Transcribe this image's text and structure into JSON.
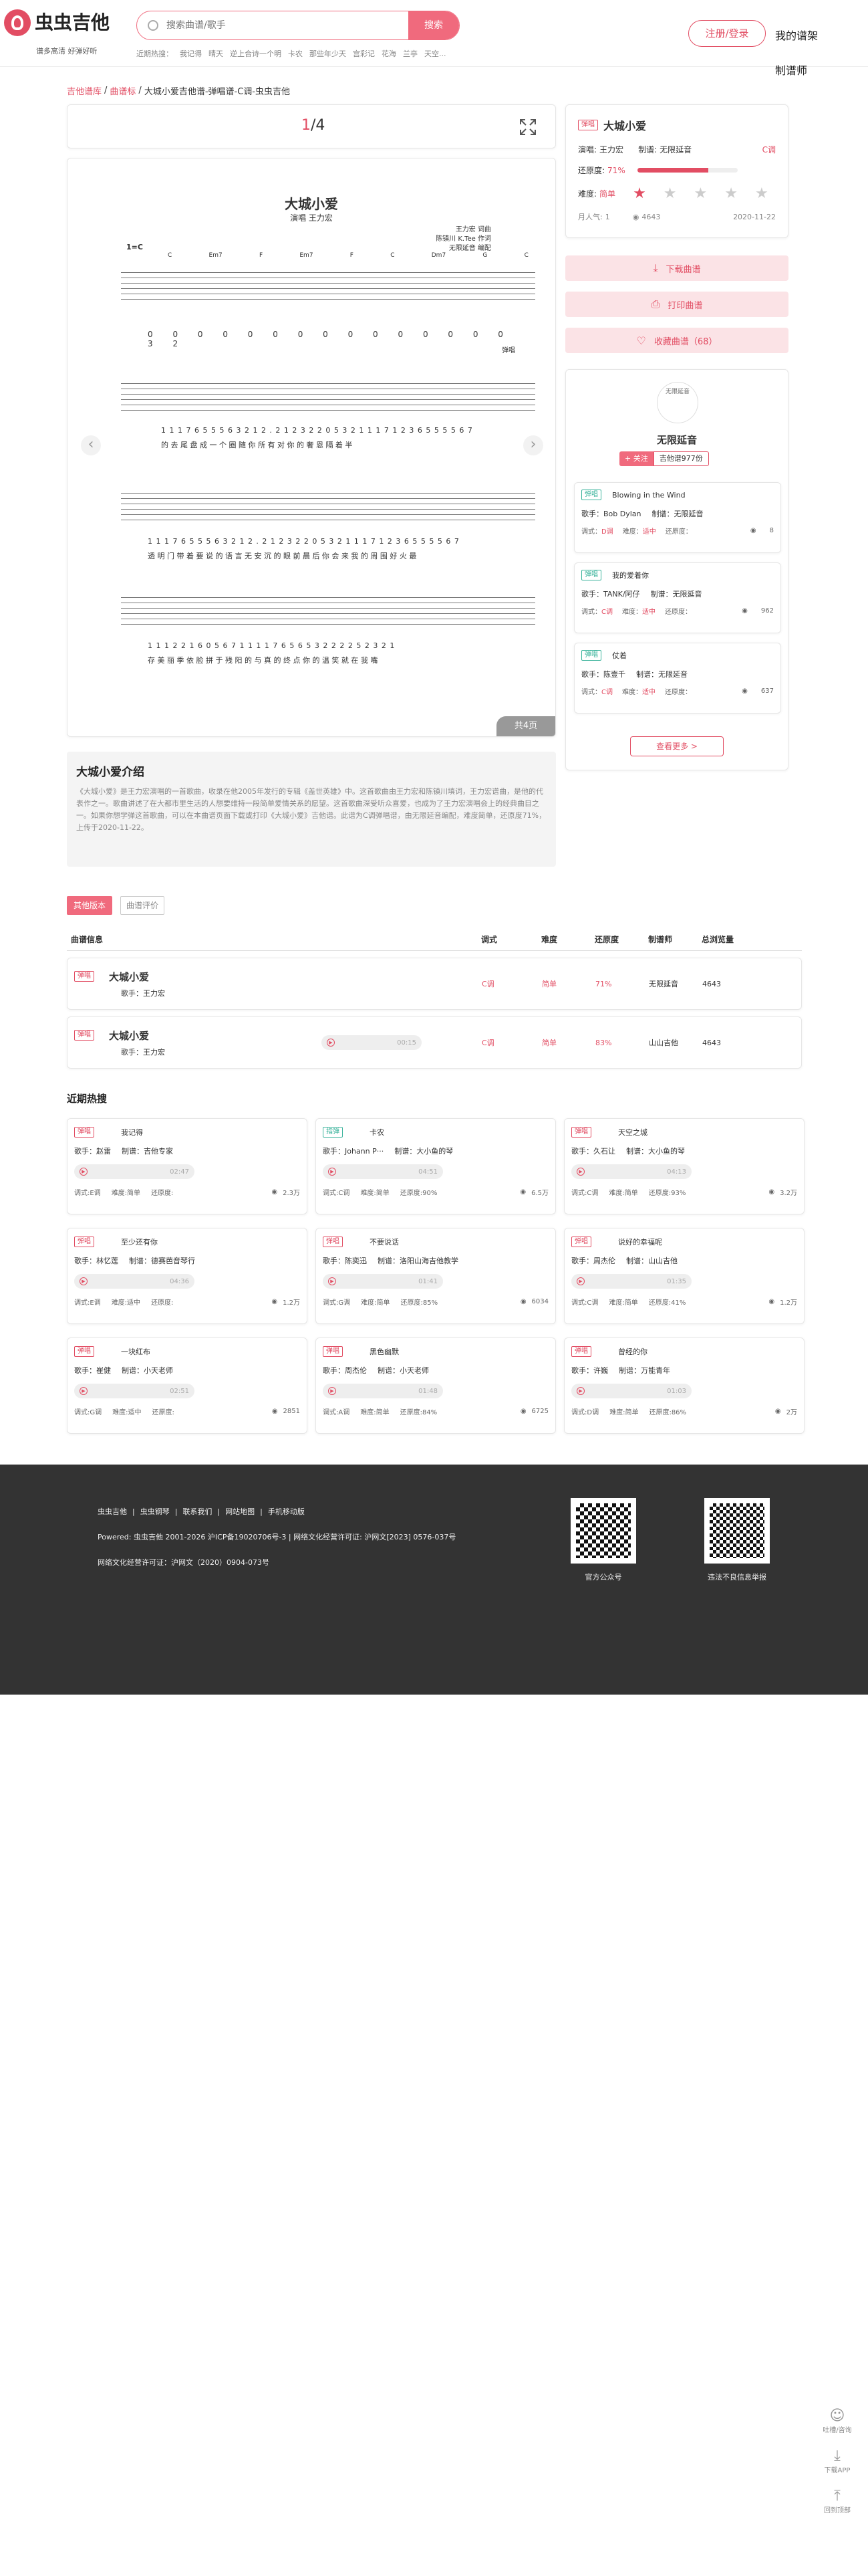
{
  "header": {
    "logo_text": "虫虫吉他",
    "tagline": "谱多高清 好弹好听",
    "search_placeholder": "搜索曲谱/歌手",
    "search_button": "搜索",
    "hot_label": "近期热搜：",
    "hot_terms": [
      "我记得",
      "晴天",
      "逆上合诗一个明",
      "卡农",
      "那些年少天",
      "宫彩记",
      "花海",
      "兰亭",
      "天空..."
    ],
    "login_button": "注册/登录",
    "my_scores": "我的谱架",
    "nav_maker": "制谱师"
  },
  "breadcrumb": {
    "home": "吉他谱库",
    "category": "曲谱标",
    "current": "大城小爱吉他谱-弹唱谱-C调-虫虫吉他"
  },
  "viewer": {
    "page_current": "1",
    "page_sep": "/4",
    "total_pages": "共4页",
    "sheet_title": "大城小爱",
    "sheet_sub": "演唱 王力宏",
    "credits": [
      "王力宏 词曲",
      "陈镇川 K.Tee 作词",
      "无限延音 编配"
    ],
    "key_sign": "1=C",
    "player_tag": "弹唱",
    "lyrics_1": "的 去 尾 盘 成 一 个 圈 随 你 所 有 对 你 的 奢 恩 隔 着 半",
    "lyrics_2": "透 明 门 带 着 要 说 的 语 言 无 安 沉 的 眼 前 晨 后 你 会 来 我 的 周 围 好 火 最",
    "lyrics_3": "存 美 丽 季 依 脸 拼 于 残 阳 的 与 真 的 终 点 你 的 温 笑 就 在 我 嘴",
    "numbers_1": "1 1 1 7 6 5 5 5 6 3 2 1 2 . 2 1 2 3 2 2 0 5 3 2 1 1 1 7 1 2 3 6 5 5 5 5 6 7",
    "numbers_2": "1 1 1 2 2 1 6 0 5 6 7 1 1 1 1 7 6 5 6 5 3 2 2 2 2 5 2 3 2 1"
  },
  "song": {
    "tag": "弹唱",
    "title": "大城小爱",
    "singer_label": "演唱:",
    "singer": "王力宏",
    "maker_label": "制谱:",
    "maker": "无限延音",
    "key": "C调",
    "restore_label": "还原度:",
    "restore_value": "71%",
    "restore_fraction": 0.71,
    "difficulty_label": "难度:",
    "difficulty": "简单",
    "difficulty_stars": 1,
    "popularity_label": "月人气:",
    "popularity": "1",
    "views": "4643",
    "date": "2020-11-22"
  },
  "actions": {
    "download": "下载曲谱",
    "print": "打印曲谱",
    "favorite": "收藏曲谱",
    "favorite_count": "（68）"
  },
  "author": {
    "avatar_alt": "无限延音",
    "name": "无限延音",
    "follow": "+ 关注",
    "score_count": "吉他谱977份",
    "songs": [
      {
        "tag": "弹唱",
        "title": "Blowing in the Wind",
        "singer_label": "歌手：",
        "singer": "Bob Dylan",
        "maker_label": "制谱：",
        "maker": "无限延音",
        "key_label": "调式：",
        "key": "D调",
        "diff_label": "难度：",
        "diff": "适中",
        "restore_label": "还原度：",
        "views": "8"
      },
      {
        "tag": "弹唱",
        "title": "我的爱着你",
        "singer_label": "歌手：",
        "singer": "TANK/阿仔",
        "maker_label": "制谱：",
        "maker": "无限延音",
        "key_label": "调式：",
        "key": "C调",
        "diff_label": "难度：",
        "diff": "适中",
        "restore_label": "还原度：",
        "views": "962"
      },
      {
        "tag": "弹唱",
        "title": "仗着",
        "singer_label": "歌手：",
        "singer": "陈壹千",
        "maker_label": "制谱：",
        "maker": "无限延音",
        "key_label": "调式：",
        "key": "C调",
        "diff_label": "难度：",
        "diff": "适中",
        "restore_label": "还原度：",
        "views": "637"
      }
    ],
    "more": "查看更多 >"
  },
  "intro": {
    "title": "大城小爱介绍",
    "text": "《大城小爱》是王力宏演唱的一首歌曲，收录在他2005年发行的专辑《盖世英雄》中。这首歌曲由王力宏和陈镇川填词，王力宏谱曲，是他的代表作之一。歌曲讲述了在大都市里生活的人想要维持一段简单爱情关系的愿望。这首歌曲深受听众喜爱，也成为了王力宏演唱会上的经典曲目之一。如果你想学弹这首歌曲，可以在本曲谱页面下载或打印《大城小爱》吉他谱。此谱为C调弹唱谱，由无限延音编配，难度简单，还原度71%，上传于2020-11-22。"
  },
  "versions": {
    "tab_other": "其他版本",
    "tab_review": "曲谱评价",
    "headers": [
      "曲谱信息",
      "调式",
      "难度",
      "还原度",
      "制谱师",
      "总浏览量"
    ],
    "rows": [
      {
        "tag": "弹唱",
        "title": "大城小爱",
        "singer": "歌手：王力宏",
        "audio": "",
        "key": "C调",
        "diff": "简单",
        "restore": "71%",
        "maker": "无限延音",
        "views": "4643"
      },
      {
        "tag": "弹唱",
        "title": "大城小爱",
        "singer": "歌手：王力宏",
        "audio": "00:15",
        "key": "C调",
        "diff": "简单",
        "restore": "83%",
        "maker": "山山吉他",
        "views": "4643"
      }
    ]
  },
  "hot": {
    "title": "近期热搜",
    "cards": [
      {
        "tag": "弹唱",
        "green": false,
        "title": "我记得",
        "singer": "歌手：赵雷",
        "maker": "制谱：吉他专家",
        "audio": "02:47",
        "key": "调式:E调",
        "diff": "难度:简单",
        "restore": "还原度:",
        "views": "2.3万"
      },
      {
        "tag": "指弹",
        "green": true,
        "title": "卡农",
        "singer": "歌手：Johann P···",
        "maker": "制谱：大小鱼的琴",
        "audio": "04:51",
        "key": "调式:C调",
        "diff": "难度:简单",
        "restore": "还原度:90%",
        "views": "6.5万"
      },
      {
        "tag": "弹唱",
        "green": false,
        "title": "天空之城",
        "singer": "歌手：久石让",
        "maker": "制谱：大小鱼的琴",
        "audio": "04:13",
        "key": "调式:C调",
        "diff": "难度:简单",
        "restore": "还原度:93%",
        "views": "3.2万"
      },
      {
        "tag": "弹唱",
        "green": false,
        "title": "至少还有你",
        "singer": "歌手：林忆莲",
        "maker": "制谱：德赛芭音琴行",
        "audio": "04:36",
        "key": "调式:E调",
        "diff": "难度:适中",
        "restore": "还原度:",
        "views": "1.2万"
      },
      {
        "tag": "弹唱",
        "green": false,
        "title": "不要说话",
        "singer": "歌手：陈奕迅",
        "maker": "制谱：洛阳山海吉他教学",
        "audio": "01:41",
        "key": "调式:G调",
        "diff": "难度:简单",
        "restore": "还原度:85%",
        "views": "6034"
      },
      {
        "tag": "弹唱",
        "green": false,
        "title": "说好的幸福呢",
        "singer": "歌手：周杰伦",
        "maker": "制谱：山山吉他",
        "audio": "01:35",
        "key": "调式:C调",
        "diff": "难度:简单",
        "restore": "还原度:41%",
        "views": "1.2万"
      },
      {
        "tag": "弹唱",
        "green": false,
        "title": "一块红布",
        "singer": "歌手：崔健",
        "maker": "制谱：小天老师",
        "audio": "02:51",
        "key": "调式:G调",
        "diff": "难度:适中",
        "restore": "还原度:",
        "views": "2851"
      },
      {
        "tag": "弹唱",
        "green": false,
        "title": "黑色幽默",
        "singer": "歌手：周杰伦",
        "maker": "制谱：小天老师",
        "audio": "01:48",
        "key": "调式:A调",
        "diff": "难度:简单",
        "restore": "还原度:84%",
        "views": "6725"
      },
      {
        "tag": "弹唱",
        "green": false,
        "title": "曾经的你",
        "singer": "歌手：许巍",
        "maker": "制谱：万能青年",
        "audio": "01:03",
        "key": "调式:D调",
        "diff": "难度:简单",
        "restore": "还原度:86%",
        "views": "2万"
      }
    ]
  },
  "footer": {
    "links": [
      "虫虫吉他",
      "虫虫钢琴",
      "联系我们",
      "网站地图",
      "手机移动版"
    ],
    "powered": "Powered: 虫虫吉他 2001-2026 沪ICP备19020706号-3 | 网络文化经营许可证: 沪网文[2023] 0576-037号",
    "license": "网络文化经营许可证：沪网文（2020）0904-073号",
    "qr1": "官方公众号",
    "qr2": "违法不良信息举报"
  },
  "sidebar_float": {
    "feedback": "吐槽/咨询",
    "app": "下载APP",
    "top": "回到顶部"
  }
}
